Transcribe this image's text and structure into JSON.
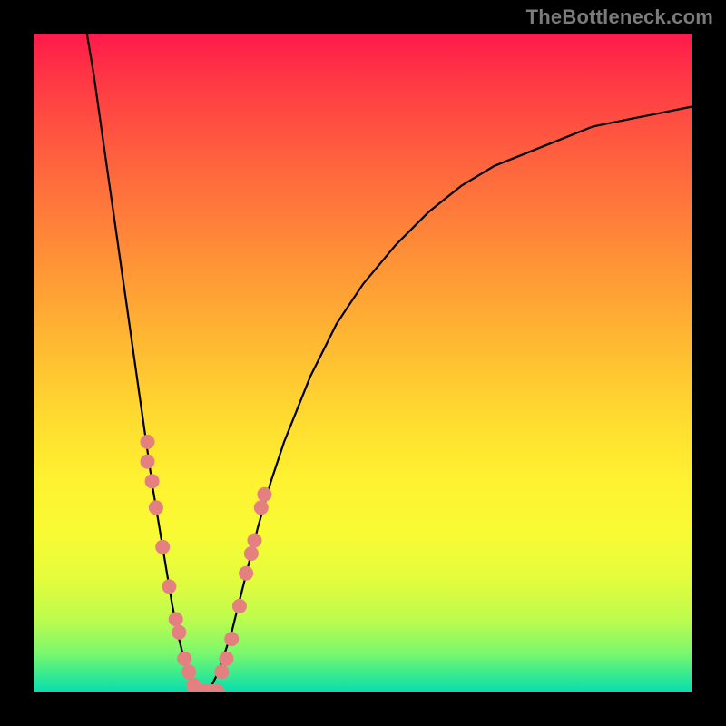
{
  "watermark": "TheBottleneck.com",
  "chart_data": {
    "type": "line",
    "title": "",
    "xlabel": "",
    "ylabel": "",
    "xlim": [
      0,
      100
    ],
    "ylim": [
      0,
      100
    ],
    "gradient_background": {
      "top_color": "#ff1a4a",
      "bottom_color": "#0adcb0",
      "description": "vertical rainbow gradient red-orange-yellow-green"
    },
    "series": [
      {
        "name": "bottleneck-curve",
        "description": "V-shaped curve, steep left leg, shallower right leg",
        "x": [
          8,
          9,
          10,
          11,
          12,
          13,
          14,
          15,
          16,
          17,
          18,
          19,
          20,
          21,
          22,
          23,
          24,
          25,
          26,
          27,
          28,
          29,
          30,
          31,
          32,
          33,
          34,
          36,
          38,
          40,
          42,
          44,
          46,
          48,
          50,
          55,
          60,
          65,
          70,
          75,
          80,
          85,
          90,
          95,
          100
        ],
        "y": [
          100,
          94,
          87,
          80,
          73,
          66,
          59,
          52,
          45,
          38,
          31,
          25,
          19,
          13,
          8,
          4,
          1,
          0,
          0,
          1,
          3,
          6,
          9,
          13,
          17,
          21,
          25,
          32,
          38,
          43,
          48,
          52,
          56,
          59,
          62,
          68,
          73,
          77,
          80,
          82,
          84,
          86,
          87,
          88,
          89
        ]
      },
      {
        "name": "highlighted-points-left-leg",
        "type": "scatter",
        "marker_color": "#e58080",
        "x": [
          17.2,
          17.2,
          17.9,
          18.5,
          19.5,
          20.5,
          21.5,
          22.0,
          22.8,
          23.5,
          24.2
        ],
        "y": [
          38,
          35,
          32,
          28,
          22,
          16,
          11,
          9,
          5,
          3,
          1
        ]
      },
      {
        "name": "highlighted-points-bottom",
        "type": "scatter",
        "marker_color": "#e58080",
        "x": [
          24.8,
          25.5,
          26.2,
          27.0,
          27.8
        ],
        "y": [
          0,
          0,
          0,
          0,
          0
        ]
      },
      {
        "name": "highlighted-points-right-leg",
        "type": "scatter",
        "marker_color": "#e58080",
        "x": [
          28.5,
          29.2,
          30.0,
          31.2,
          32.2,
          33.0,
          33.5,
          34.5,
          35.0
        ],
        "y": [
          3,
          5,
          8,
          13,
          18,
          21,
          23,
          28,
          30
        ]
      }
    ]
  }
}
